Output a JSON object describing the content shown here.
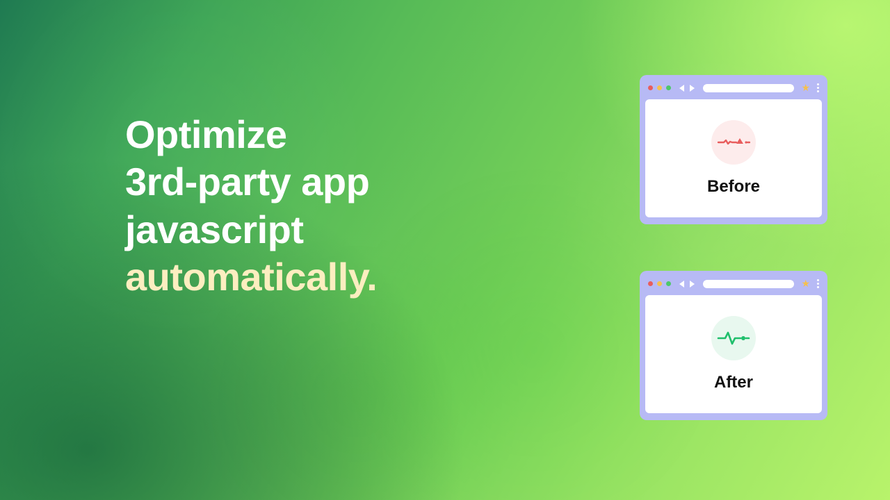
{
  "headline": {
    "line1": "Optimize",
    "line2": "3rd-party app",
    "line3": "javascript",
    "line4": "automatically."
  },
  "cards": {
    "before": {
      "label": "Before"
    },
    "after": {
      "label": "After"
    }
  },
  "colors": {
    "accent_text": "#fceec0",
    "card_frame": "#b7baf5",
    "signal_bad": "#e85d5d",
    "signal_good": "#1fbf6c"
  }
}
